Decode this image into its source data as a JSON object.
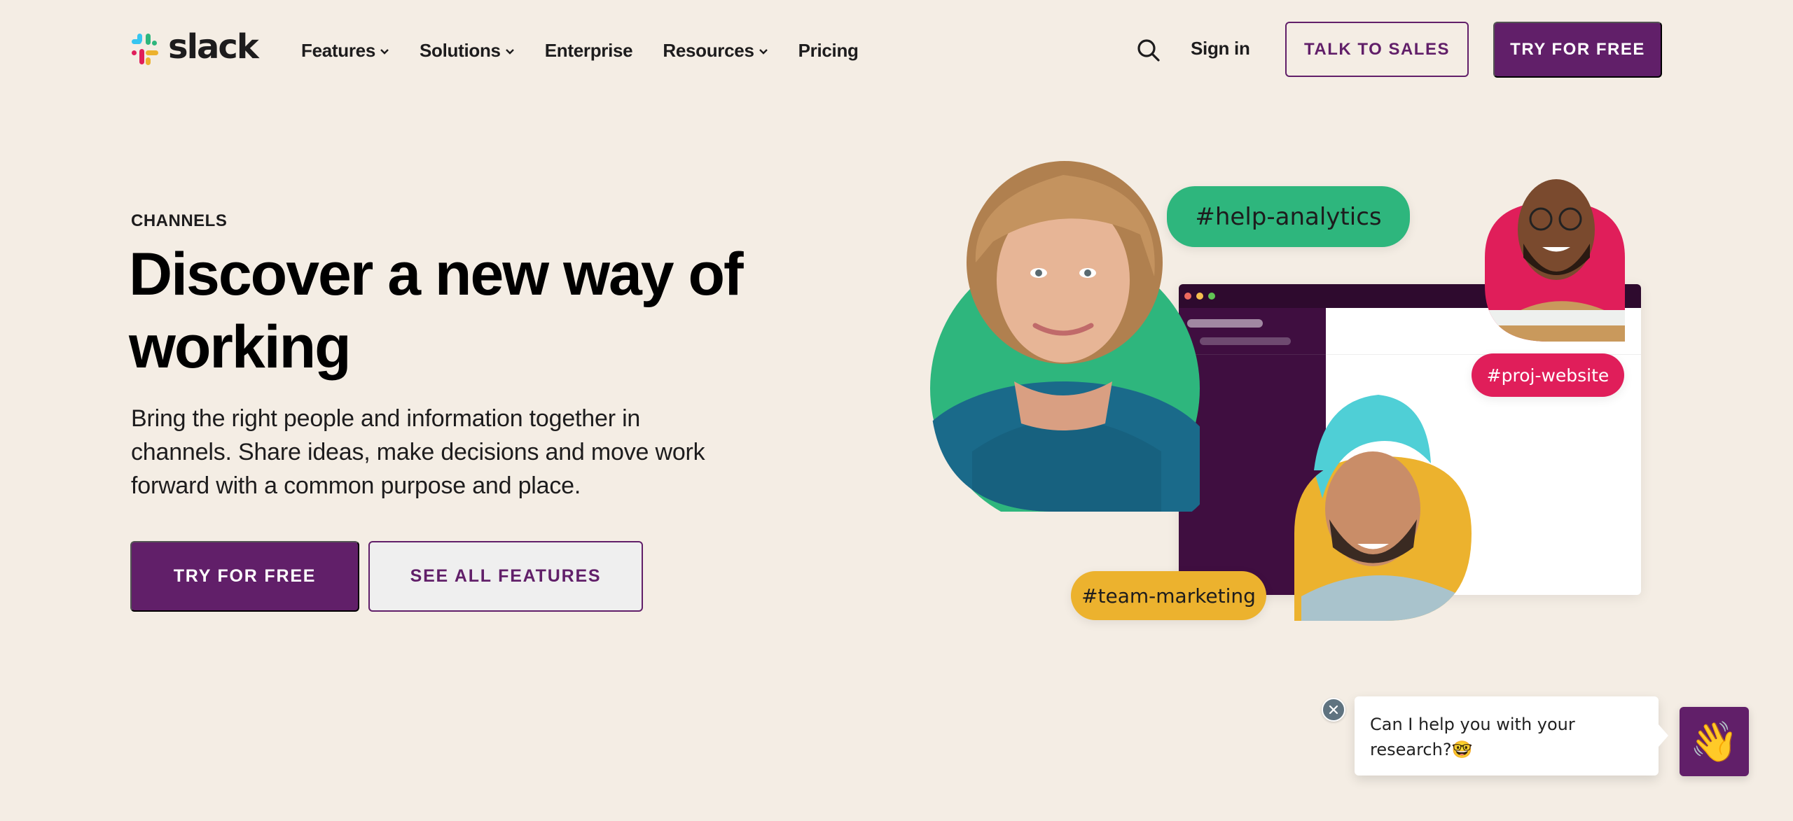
{
  "header": {
    "brand": "slack",
    "nav": [
      {
        "label": "Features",
        "has_dropdown": true
      },
      {
        "label": "Solutions",
        "has_dropdown": true
      },
      {
        "label": "Enterprise",
        "has_dropdown": false
      },
      {
        "label": "Resources",
        "has_dropdown": true
      },
      {
        "label": "Pricing",
        "has_dropdown": false
      }
    ],
    "search_icon": "search-icon",
    "sign_in": "Sign in",
    "talk_to_sales": "TALK TO SALES",
    "try_for_free": "TRY FOR FREE"
  },
  "hero": {
    "eyebrow": "CHANNELS",
    "headline": "Discover a new way of working",
    "subcopy": "Bring the right people and information together in channels. Share ideas, make decisions and move work forward with a common purpose and place.",
    "primary_cta": "TRY FOR FREE",
    "secondary_cta": "SEE ALL FEATURES"
  },
  "illustration": {
    "channels": [
      {
        "label": "#help-analytics",
        "color": "#2eb67d",
        "text_color": "#1d1c1d"
      },
      {
        "label": "#proj-website",
        "color": "#e01e5a",
        "text_color": "#ffffff"
      },
      {
        "label": "#team-marketing",
        "color": "#ecb22e",
        "text_color": "#1d1c1d"
      }
    ],
    "window_dots": [
      "#ed6a5e",
      "#f5bf4f",
      "#61c554"
    ]
  },
  "chat_widget": {
    "message": "Can I help you with your research?🤓",
    "launcher_emoji": "👋",
    "close_icon": "close-icon"
  },
  "colors": {
    "brand_purple": "#611f69",
    "background": "#f4ede4",
    "slack_blue": "#36c5f0",
    "slack_green": "#2eb67d",
    "slack_red": "#e01e5a",
    "slack_yellow": "#ecb22e"
  }
}
